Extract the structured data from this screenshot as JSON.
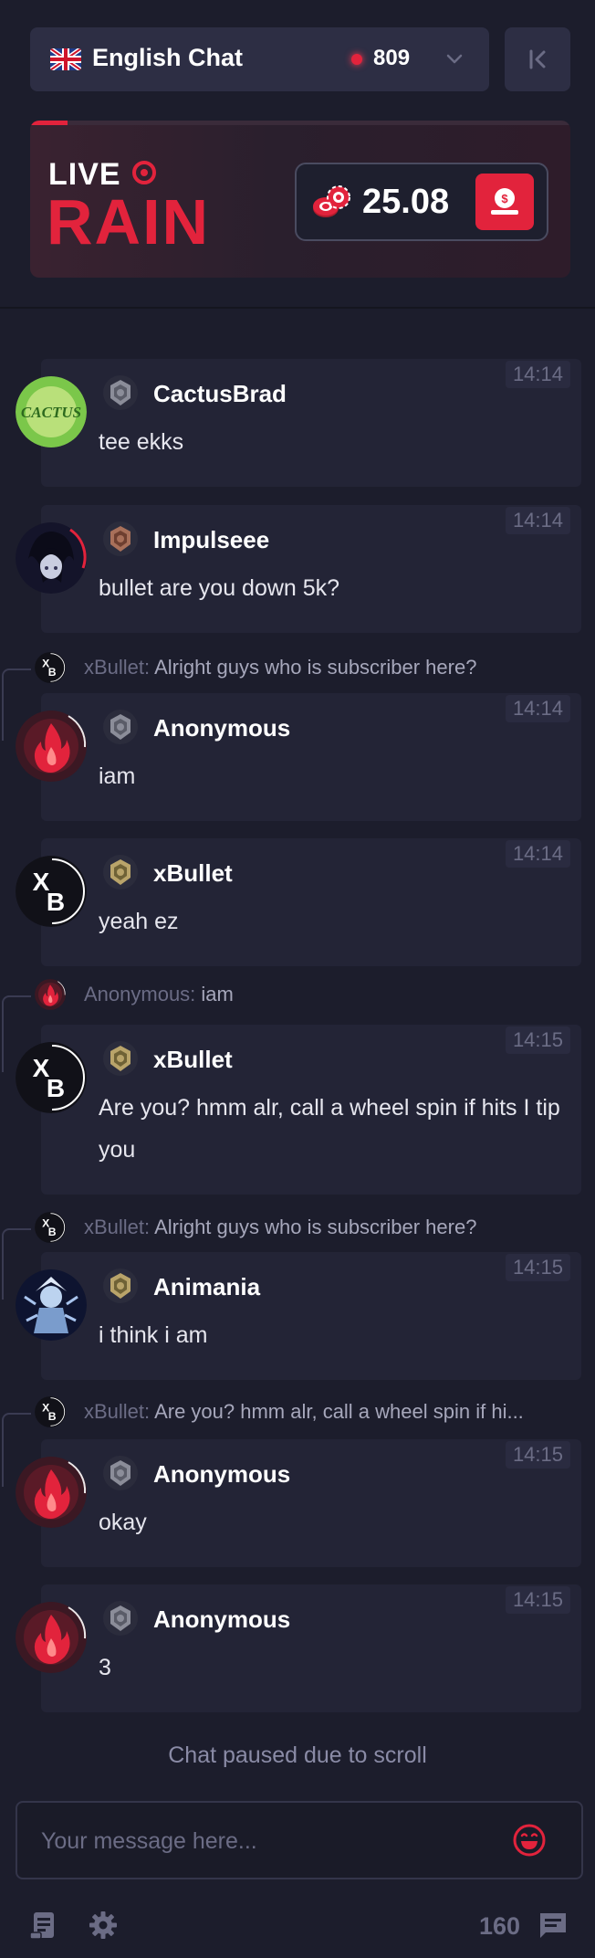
{
  "header": {
    "language_label": "English Chat",
    "online_count": "809",
    "rain": {
      "live_label": "LIVE",
      "rain_label": "RAIN",
      "amount": "25.08",
      "progress": 0.07
    }
  },
  "messages": [
    {
      "id": "m1",
      "user": "CactusBrad",
      "time": "14:14",
      "text": "tee ekks",
      "avatar": "cactus",
      "rank": "silver"
    },
    {
      "id": "m2",
      "user": "Impulseee",
      "time": "14:14",
      "text": "bullet are you down 5k?",
      "avatar": "anime-dark",
      "rank": "bronze"
    },
    {
      "id": "m3",
      "reply": {
        "user": "xBullet:",
        "text": "Alright guys who is subscriber here?",
        "avatar": "xb"
      },
      "user": "Anonymous",
      "time": "14:14",
      "text": "iam",
      "avatar": "flame",
      "rank": "silver"
    },
    {
      "id": "m4",
      "user": "xBullet",
      "time": "14:14",
      "text": "yeah ez",
      "avatar": "xb",
      "rank": "gold"
    },
    {
      "id": "m5",
      "reply": {
        "user": "Anonymous:",
        "text": "iam",
        "avatar": "flame"
      },
      "user": "xBullet",
      "time": "14:15",
      "text": "Are you? hmm alr, call a wheel spin if hits I tip you",
      "avatar": "xb",
      "rank": "gold"
    },
    {
      "id": "m6",
      "reply": {
        "user": "xBullet:",
        "text": "Alright guys who is subscriber here?",
        "avatar": "xb"
      },
      "user": "Animania",
      "time": "14:15",
      "text": "i think i am",
      "avatar": "anime-blue",
      "rank": "gold"
    },
    {
      "id": "m7",
      "reply": {
        "user": "xBullet:",
        "text": "Are you? hmm alr, call a wheel spin if hi...",
        "avatar": "xb"
      },
      "user": "Anonymous",
      "time": "14:15",
      "text": "okay",
      "avatar": "flame",
      "rank": "silver"
    },
    {
      "id": "m8",
      "user": "Anonymous",
      "time": "14:15",
      "text": "3",
      "avatar": "flame",
      "rank": "silver"
    }
  ],
  "footer": {
    "paused_text": "Chat paused due to scroll",
    "input_placeholder": "Your message here...",
    "message_count": "160"
  },
  "colors": {
    "background": "#1c1d2c",
    "card": "#232436",
    "accent_red": "#e2233c",
    "muted": "#6b6c85"
  },
  "icons": [
    "uk-flag-icon",
    "chevron-down-icon",
    "collapse-left-icon",
    "chips-icon",
    "tip-rain-icon",
    "emoji-icon",
    "rules-icon",
    "gear-icon",
    "chat-bubble-icon"
  ]
}
